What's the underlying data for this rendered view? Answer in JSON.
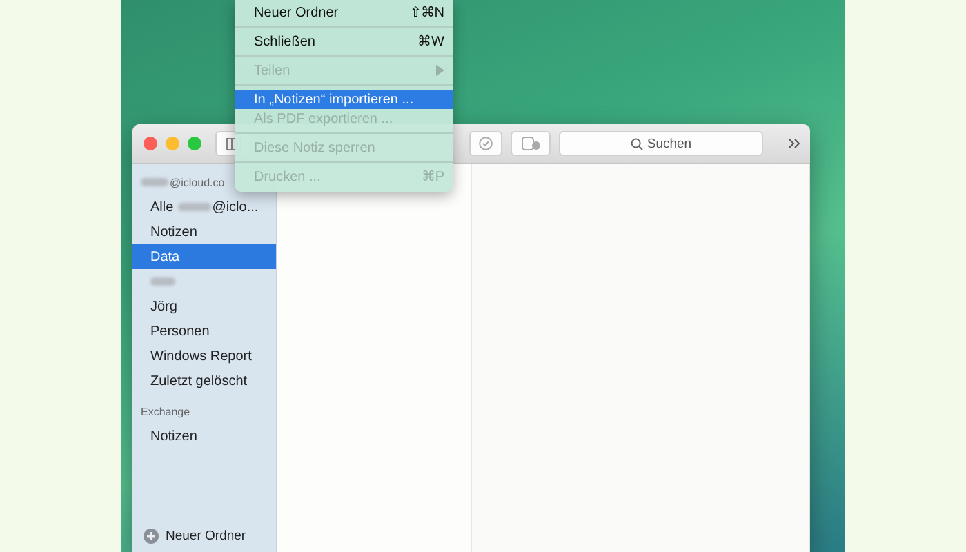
{
  "menu": {
    "items": [
      {
        "kind": "item",
        "label": "Neuer Ordner",
        "shortcut": "⇧⌘N",
        "disabled": false,
        "selected": false
      },
      {
        "kind": "separator"
      },
      {
        "kind": "item",
        "label": "Schließen",
        "shortcut": "⌘W",
        "disabled": false,
        "selected": false
      },
      {
        "kind": "separator"
      },
      {
        "kind": "submenu",
        "label": "Teilen",
        "disabled": true,
        "selected": false
      },
      {
        "kind": "separator"
      },
      {
        "kind": "item",
        "label": "In „Notizen“ importieren ...",
        "disabled": false,
        "selected": true
      },
      {
        "kind": "item",
        "label": "Als PDF exportieren ...",
        "disabled": true,
        "selected": false
      },
      {
        "kind": "separator"
      },
      {
        "kind": "item",
        "label": "Diese Notiz sperren",
        "disabled": true,
        "selected": false
      },
      {
        "kind": "separator"
      },
      {
        "kind": "item",
        "label": "Drucken ...",
        "shortcut": "⌘P",
        "disabled": true,
        "selected": false
      }
    ]
  },
  "toolbar": {
    "search": {
      "placeholder": "Suchen"
    }
  },
  "sidebar": {
    "sections": [
      {
        "header": "@icloud.co",
        "header_redacted": true,
        "items": [
          {
            "kind": "masked",
            "label": "Alle",
            "suffix": "@iclo...",
            "selected": false
          },
          {
            "kind": "plain",
            "label": "Notizen",
            "selected": false
          },
          {
            "kind": "plain",
            "label": "Data",
            "selected": true
          },
          {
            "kind": "redacted",
            "selected": false
          },
          {
            "kind": "plain",
            "label": "Jörg",
            "selected": false
          },
          {
            "kind": "plain",
            "label": "Personen",
            "selected": false
          },
          {
            "kind": "plain",
            "label": "Windows Report",
            "selected": false
          },
          {
            "kind": "plain",
            "label": "Zuletzt gelöscht",
            "selected": false
          }
        ]
      },
      {
        "header": "Exchange",
        "header_redacted": false,
        "items": [
          {
            "kind": "plain",
            "label": "Notizen",
            "selected": false
          }
        ]
      }
    ],
    "footer": {
      "label": "Neuer Ordner"
    }
  }
}
